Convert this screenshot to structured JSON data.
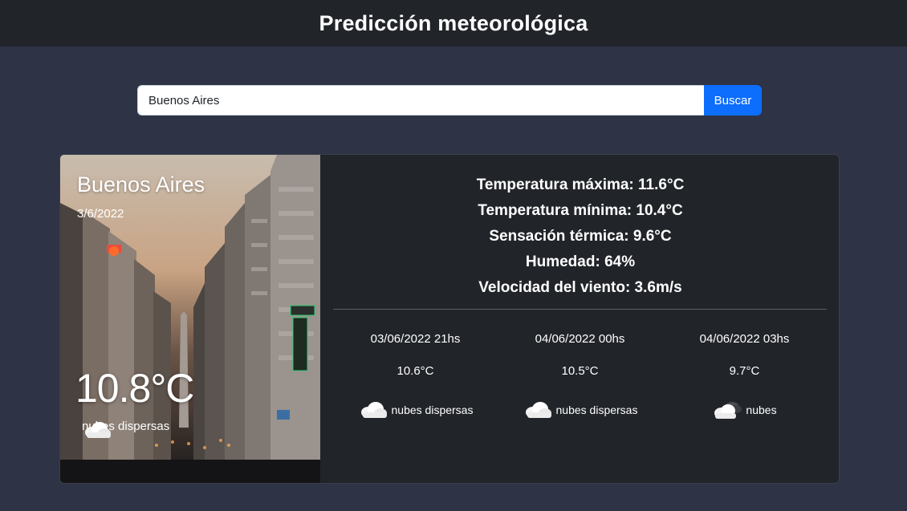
{
  "header": {
    "title": "Predicción meteorológica"
  },
  "search": {
    "value": "Buenos Aires",
    "button_label": "Buscar"
  },
  "current": {
    "city": "Buenos Aires",
    "date": "3/6/2022",
    "temperature": "10.8°C",
    "condition": "nubes dispersas",
    "condition_icon": "scattered-clouds-icon"
  },
  "stats": {
    "max": "Temperatura máxima: 11.6°C",
    "min": "Temperatura mínima: 10.4°C",
    "feels": "Sensación térmica: 9.6°C",
    "humidity": "Humedad: 64%",
    "wind": "Velocidad del viento: 3.6m/s"
  },
  "forecast": [
    {
      "datetime": "03/06/2022 21hs",
      "temp": "10.6°C",
      "condition": "nubes dispersas",
      "icon": "scattered-clouds-icon"
    },
    {
      "datetime": "04/06/2022 00hs",
      "temp": "10.5°C",
      "condition": "nubes dispersas",
      "icon": "scattered-clouds-icon"
    },
    {
      "datetime": "04/06/2022 03hs",
      "temp": "9.7°C",
      "condition": "nubes",
      "icon": "broken-clouds-icon"
    }
  ],
  "colors": {
    "background": "#2e3346",
    "navbar": "#212429",
    "card": "#212429",
    "accent": "#0d6efd"
  }
}
